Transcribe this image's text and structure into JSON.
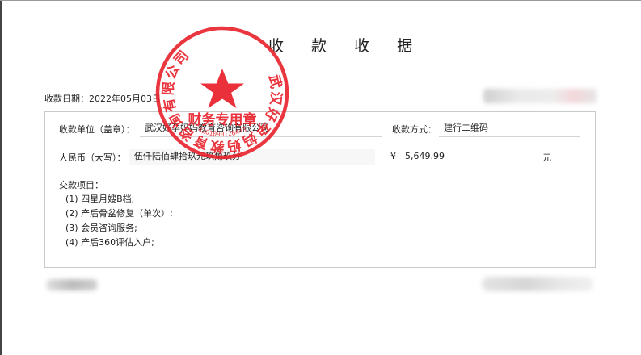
{
  "receipt": {
    "title": "收 款 收 据",
    "date_label": "收款日期：",
    "date_value": "2022年05月03日",
    "payer_unit_label": "收款单位（盖章）：",
    "payer_unit_value": "武汉好孕妈妈教育咨询有限公司",
    "payment_method_label": "收款方式：",
    "payment_method_value": "建行二维码",
    "rmb_upper_label": "人民币（大写）：",
    "rmb_upper_value": "伍仟陆佰肆拾玖元玖角玖分",
    "currency_symbol": "¥",
    "amount_value": "5,649.99",
    "unit_yuan": "元",
    "items_label": "交款项目：",
    "items": [
      "(1) 四星月嫂B档;",
      "(2) 产后骨盆修复（单次）;",
      "(3) 会员咨询服务;",
      "(4) 产后360评估入户;"
    ]
  },
  "stamp": {
    "company_ring_text": "武汉好孕妈妈教育咨询有限公司",
    "center_text": "财务专用章",
    "serial_number": "4201090126443",
    "color": "#e8202a"
  }
}
